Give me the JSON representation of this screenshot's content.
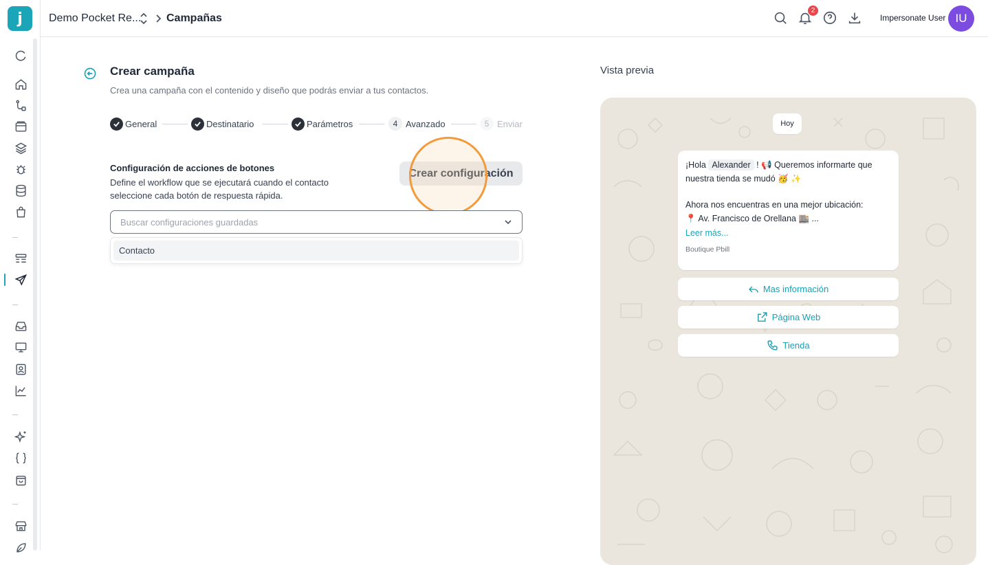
{
  "topbar": {
    "org_name": "Demo Pocket Re...",
    "breadcrumb_page": "Campañas",
    "notification_count": "2",
    "user_name": "Impersonate User",
    "user_initials": "IU"
  },
  "sidebar": {
    "logo_letter": "j",
    "items": [
      "refresh-icon",
      "home-icon",
      "flow-icon",
      "archive-icon",
      "layers-icon",
      "bug-icon",
      "database-icon",
      "bag-icon",
      "list-icon",
      "send-icon",
      "inbox-icon",
      "monitor-icon",
      "contact-icon",
      "chart-icon",
      "sparkles-icon",
      "braces-icon",
      "store-bag-icon",
      "shop-icon",
      "leaf-icon"
    ],
    "active_item": "send-icon"
  },
  "form": {
    "title": "Crear campaña",
    "subtitle": "Crea una campaña con el contenido y diseño que podrás enviar a tus contactos.",
    "steps": [
      {
        "label": "General",
        "state": "done"
      },
      {
        "label": "Destinatario",
        "state": "done"
      },
      {
        "label": "Parámetros",
        "state": "done"
      },
      {
        "label": "Avanzado",
        "number": "4",
        "state": "current"
      },
      {
        "label": "Enviar",
        "number": "5",
        "state": "pending"
      }
    ],
    "section_title": "Configuración de acciones de botones",
    "section_description": "Define el workflow que se ejecutará cuando el contacto seleccione cada botón de respuesta rápida.",
    "create_button": "Crear configuración",
    "search_placeholder": "Buscar configuraciones guardadas",
    "dropdown_options": [
      "Contacto"
    ]
  },
  "preview": {
    "title": "Vista previa",
    "date_chip": "Hoy",
    "message": {
      "line1_prefix": "¡Hola",
      "variable": "Alexander",
      "line1_suffix": "! 📢 Queremos informarte que",
      "line2": "nuestra tienda se mudó 🥳 ✨",
      "line3": "Ahora nos encuentras en una mejor ubicación:",
      "line4": "📍 Av. Francisco de Orellana 🏬 ...",
      "read_more": "Leer más...",
      "footer": "Boutique Pbill"
    },
    "buttons": [
      {
        "label": "Mas información",
        "icon": "reply-icon"
      },
      {
        "label": "Página Web",
        "icon": "external-link-icon"
      },
      {
        "label": "Tienda",
        "icon": "phone-icon"
      }
    ]
  },
  "colors": {
    "accent": "#1aa5b8",
    "avatar": "#7c4ce0",
    "badge": "#e5484d",
    "highlight": "#f39a3c",
    "chat_bg": "#ebe6dd"
  }
}
